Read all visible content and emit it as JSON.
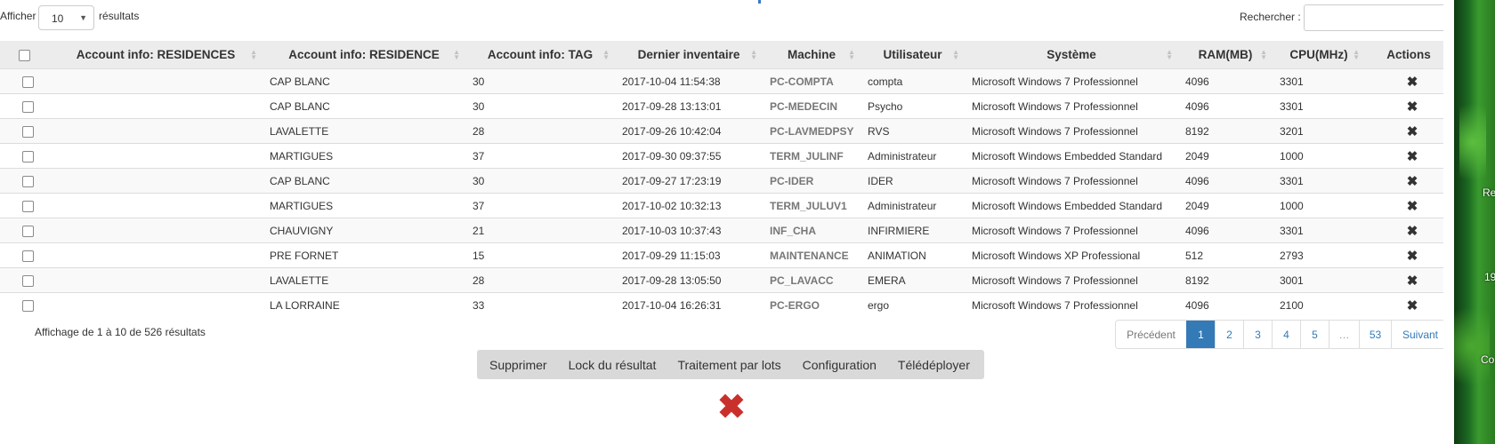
{
  "length_control": {
    "label": "Afficher",
    "value": "10",
    "suffix": "résultats"
  },
  "search": {
    "label": "Rechercher :",
    "value": ""
  },
  "table": {
    "columns": [
      "Account info: RESIDENCES",
      "Account info: RESIDENCE",
      "Account info: TAG",
      "Dernier inventaire",
      "Machine",
      "Utilisateur",
      "Système",
      "RAM(MB)",
      "CPU(MHz)",
      "Actions"
    ],
    "rows": [
      {
        "residences": "",
        "residence": "CAP BLANC",
        "tag": "30",
        "inventaire": "2017-10-04 11:54:38",
        "machine": "PC-COMPTA",
        "utilisateur": "compta",
        "systeme": "Microsoft Windows 7 Professionnel",
        "ram": "4096",
        "cpu": "3301"
      },
      {
        "residences": "",
        "residence": "CAP BLANC",
        "tag": "30",
        "inventaire": "2017-09-28 13:13:01",
        "machine": "PC-MEDECIN",
        "utilisateur": "Psycho",
        "systeme": "Microsoft Windows 7 Professionnel",
        "ram": "4096",
        "cpu": "3301"
      },
      {
        "residences": "",
        "residence": "LAVALETTE",
        "tag": "28",
        "inventaire": "2017-09-26 10:42:04",
        "machine": "PC-LAVMEDPSY",
        "utilisateur": "RVS",
        "systeme": "Microsoft Windows 7 Professionnel",
        "ram": "8192",
        "cpu": "3201"
      },
      {
        "residences": "",
        "residence": "MARTIGUES",
        "tag": "37",
        "inventaire": "2017-09-30 09:37:55",
        "machine": "TERM_JULINF",
        "utilisateur": "Administrateur",
        "systeme": "Microsoft Windows Embedded Standard",
        "ram": "2049",
        "cpu": "1000"
      },
      {
        "residences": "",
        "residence": "CAP BLANC",
        "tag": "30",
        "inventaire": "2017-09-27 17:23:19",
        "machine": "PC-IDER",
        "utilisateur": "IDER",
        "systeme": "Microsoft Windows 7 Professionnel",
        "ram": "4096",
        "cpu": "3301"
      },
      {
        "residences": "",
        "residence": "MARTIGUES",
        "tag": "37",
        "inventaire": "2017-10-02 10:32:13",
        "machine": "TERM_JULUV1",
        "utilisateur": "Administrateur",
        "systeme": "Microsoft Windows Embedded Standard",
        "ram": "2049",
        "cpu": "1000"
      },
      {
        "residences": "",
        "residence": "CHAUVIGNY",
        "tag": "21",
        "inventaire": "2017-10-03 10:37:43",
        "machine": "INF_CHA",
        "utilisateur": "INFIRMIERE",
        "systeme": "Microsoft Windows 7 Professionnel",
        "ram": "4096",
        "cpu": "3301"
      },
      {
        "residences": "",
        "residence": "PRE FORNET",
        "tag": "15",
        "inventaire": "2017-09-29 11:15:03",
        "machine": "MAINTENANCE",
        "utilisateur": "ANIMATION",
        "systeme": "Microsoft Windows XP Professional",
        "ram": "512",
        "cpu": "2793"
      },
      {
        "residences": "",
        "residence": "LAVALETTE",
        "tag": "28",
        "inventaire": "2017-09-28 13:05:50",
        "machine": "PC_LAVACC",
        "utilisateur": "EMERA",
        "systeme": "Microsoft Windows 7 Professionnel",
        "ram": "8192",
        "cpu": "3001"
      },
      {
        "residences": "",
        "residence": "LA LORRAINE",
        "tag": "33",
        "inventaire": "2017-10-04 16:26:31",
        "machine": "PC-ERGO",
        "utilisateur": "ergo",
        "systeme": "Microsoft Windows 7 Professionnel",
        "ram": "4096",
        "cpu": "2100"
      }
    ]
  },
  "info_text": "Affichage de 1 à 10 de 526 résultats",
  "pagination": {
    "prev": "Précédent",
    "pages": [
      "1",
      "2",
      "3",
      "4",
      "5",
      "…",
      "53"
    ],
    "active": "1",
    "next": "Suivant"
  },
  "actions": [
    "Supprimer",
    "Lock du résultat",
    "Traitement par lots",
    "Configuration",
    "Télédéployer"
  ],
  "icons": {
    "row_delete": "close-icon",
    "sort": "sort-icon",
    "bottom": "close-icon"
  },
  "colors": {
    "pagination_active": "#337ab7",
    "delete_big": "#c9302c"
  },
  "background_fragments": {
    "a": "Re",
    "b": "19",
    "c": "Co"
  }
}
